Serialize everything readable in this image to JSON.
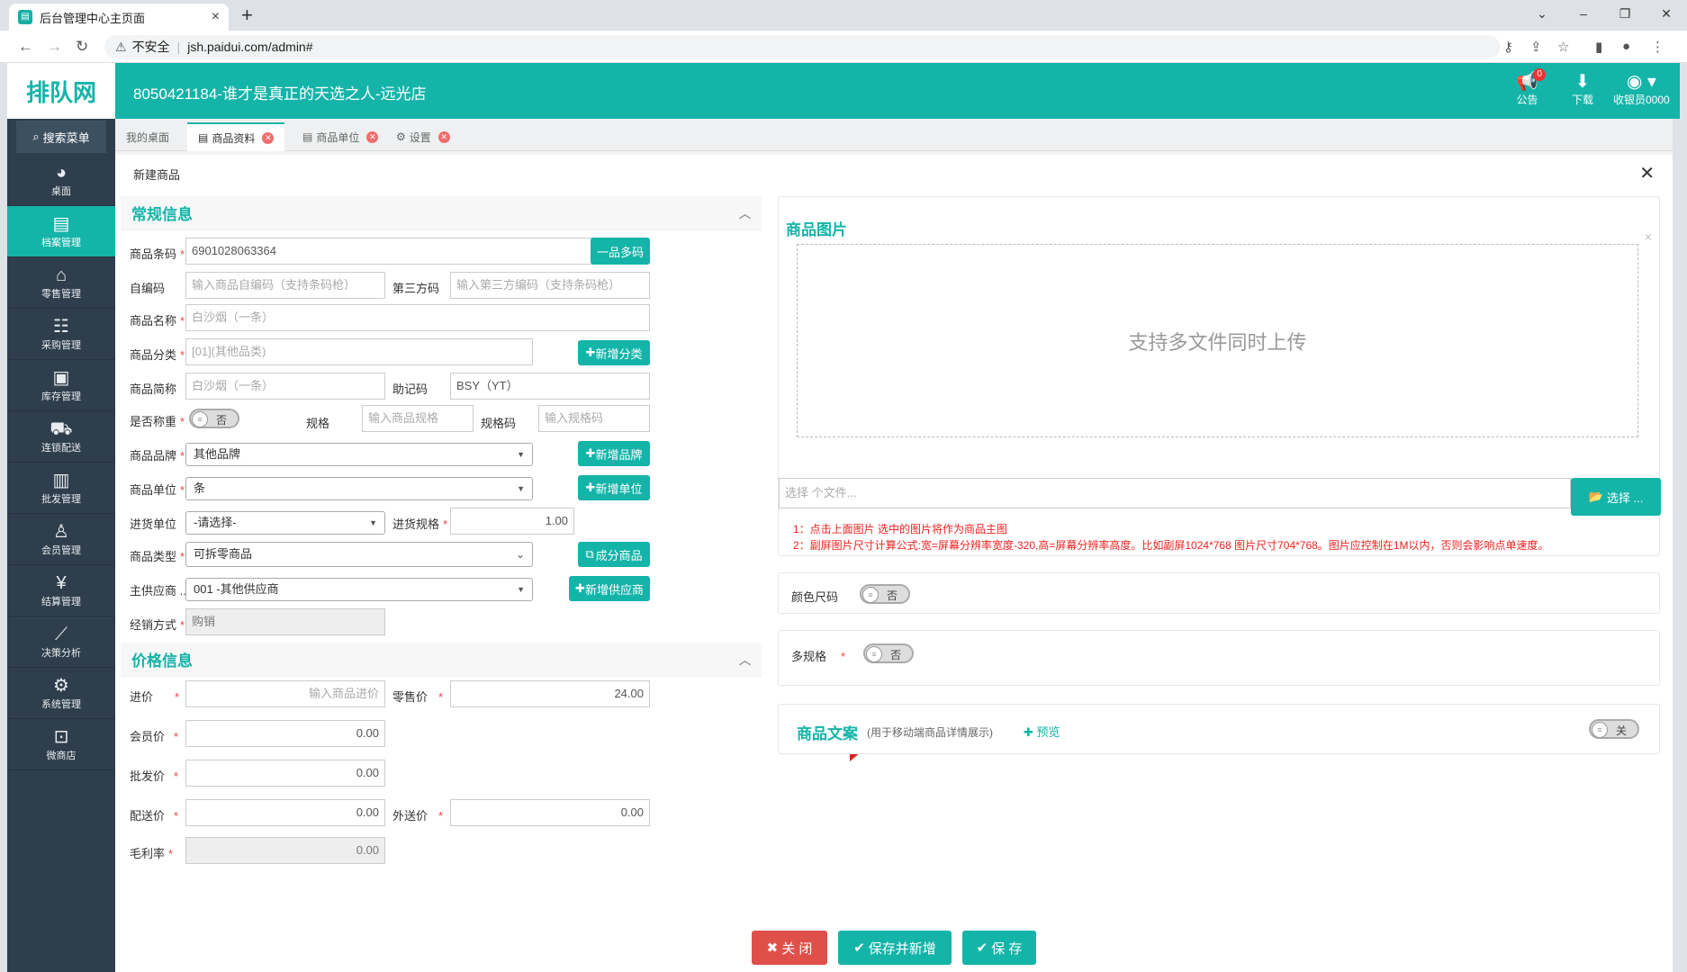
{
  "browser": {
    "tab_title": "后台管理中心主页面",
    "url_warning": "不安全",
    "url": "jsh.paidui.com/admin#"
  },
  "header": {
    "logo": "排队网",
    "shop_name": "8050421184-谁才是真正的天选之人-远光店",
    "notice_label": "公告",
    "notice_count": "0",
    "download_label": "下载",
    "user_label": "收银员0000"
  },
  "sidebar": {
    "search": "搜索菜单",
    "items": [
      {
        "label": "桌面",
        "icon": "dashboard-icon"
      },
      {
        "label": "档案管理",
        "icon": "archive-icon"
      },
      {
        "label": "零售管理",
        "icon": "store-icon"
      },
      {
        "label": "采购管理",
        "icon": "purchase-icon"
      },
      {
        "label": "库存管理",
        "icon": "inventory-icon"
      },
      {
        "label": "连锁配送",
        "icon": "delivery-icon"
      },
      {
        "label": "批发管理",
        "icon": "wholesale-icon"
      },
      {
        "label": "会员管理",
        "icon": "member-icon"
      },
      {
        "label": "结算管理",
        "icon": "settlement-icon"
      },
      {
        "label": "决策分析",
        "icon": "analysis-icon"
      },
      {
        "label": "系统管理",
        "icon": "settings-icon"
      },
      {
        "label": "微商店",
        "icon": "shop-bag-icon"
      }
    ]
  },
  "tabs": [
    "我的桌面",
    "商品资料",
    "商品单位",
    "设置"
  ],
  "dialog": {
    "title": "新建商品",
    "general_section": "常规信息",
    "barcode_label": "商品条码",
    "barcode_value": "6901028063364",
    "multi_code_btn": "一品多码",
    "self_code_label": "自编码",
    "self_code_ph": "输入商品自编码（支持条码枪）",
    "third_code_label": "第三方码",
    "third_code_ph": "输入第三方编码（支持条码枪）",
    "name_label": "商品名称",
    "name_value": "白沙烟（一条）",
    "category_label": "商品分类",
    "category_value": "[01](其他品类)",
    "add_category_btn": "新增分类",
    "short_name_label": "商品简称",
    "short_name_value": "白沙烟（一条）",
    "mnemonic_label": "助记码",
    "mnemonic_value": "BSY（YT）",
    "weigh_label": "是否称重",
    "weigh_toggle": "否",
    "spec_label": "规格",
    "spec_ph": "输入商品规格",
    "spec_code_label": "规格码",
    "spec_code_ph": "输入规格码",
    "brand_label": "商品品牌",
    "brand_value": "其他品牌",
    "add_brand_btn": "新增品牌",
    "unit_label": "商品单位",
    "unit_value": "条",
    "add_unit_btn": "新增单位",
    "purchase_unit_label": "进货单位",
    "purchase_unit_value": "-请选择-",
    "purchase_spec_label": "进货规格",
    "purchase_spec_value": "1.00",
    "type_label": "商品类型",
    "type_value": "可拆零商品",
    "component_btn": "成分商品",
    "supplier_label": "主供应商 ...",
    "supplier_value": "001 -其他供应商",
    "add_supplier_btn": "新增供应商",
    "sales_mode_label": "经销方式",
    "sales_mode_value": "购销",
    "price_section": "价格信息",
    "cost_label": "进价",
    "cost_ph": "输入商品进价",
    "retail_label": "零售价",
    "retail_value": "24.00",
    "member_label": "会员价",
    "member_value": "0.00",
    "wholesale_label": "批发价",
    "wholesale_value": "0.00",
    "delivery_label": "配送价",
    "delivery_value": "0.00",
    "outbound_label": "外送价",
    "outbound_value": "0.00",
    "profit_label": "毛利率",
    "profit_value": "0.00",
    "image_section": "商品图片",
    "upload_hint": "支持多文件同时上传",
    "file_ph": "选择 个文件...",
    "choose_btn": "选择 ...",
    "note1": "1：点击上面图片 选中的图片将作为商品主图",
    "note2": "2：副屏图片尺寸计算公式:宽=屏幕分辨率宽度-320,高=屏幕分辨率高度。比如副屏1024*768 图片尺寸704*768。图片应控制在1M以内，否则会影响点单速度。",
    "color_size_label": "颜色尺码",
    "color_size_toggle": "否",
    "multi_spec_label": "多规格",
    "multi_spec_toggle": "否",
    "copy_section": "商品文案",
    "copy_hint": "(用于移动端商品详情展示)",
    "preview_btn": "预览",
    "copy_toggle": "关",
    "close_btn": "关 闭",
    "save_new_btn": "保存并新增",
    "save_btn": "保 存"
  },
  "colors": {
    "accent": "#14b4a9",
    "sidebar": "#2e3e4c",
    "danger": "#e0504a",
    "required": "#e44444"
  }
}
